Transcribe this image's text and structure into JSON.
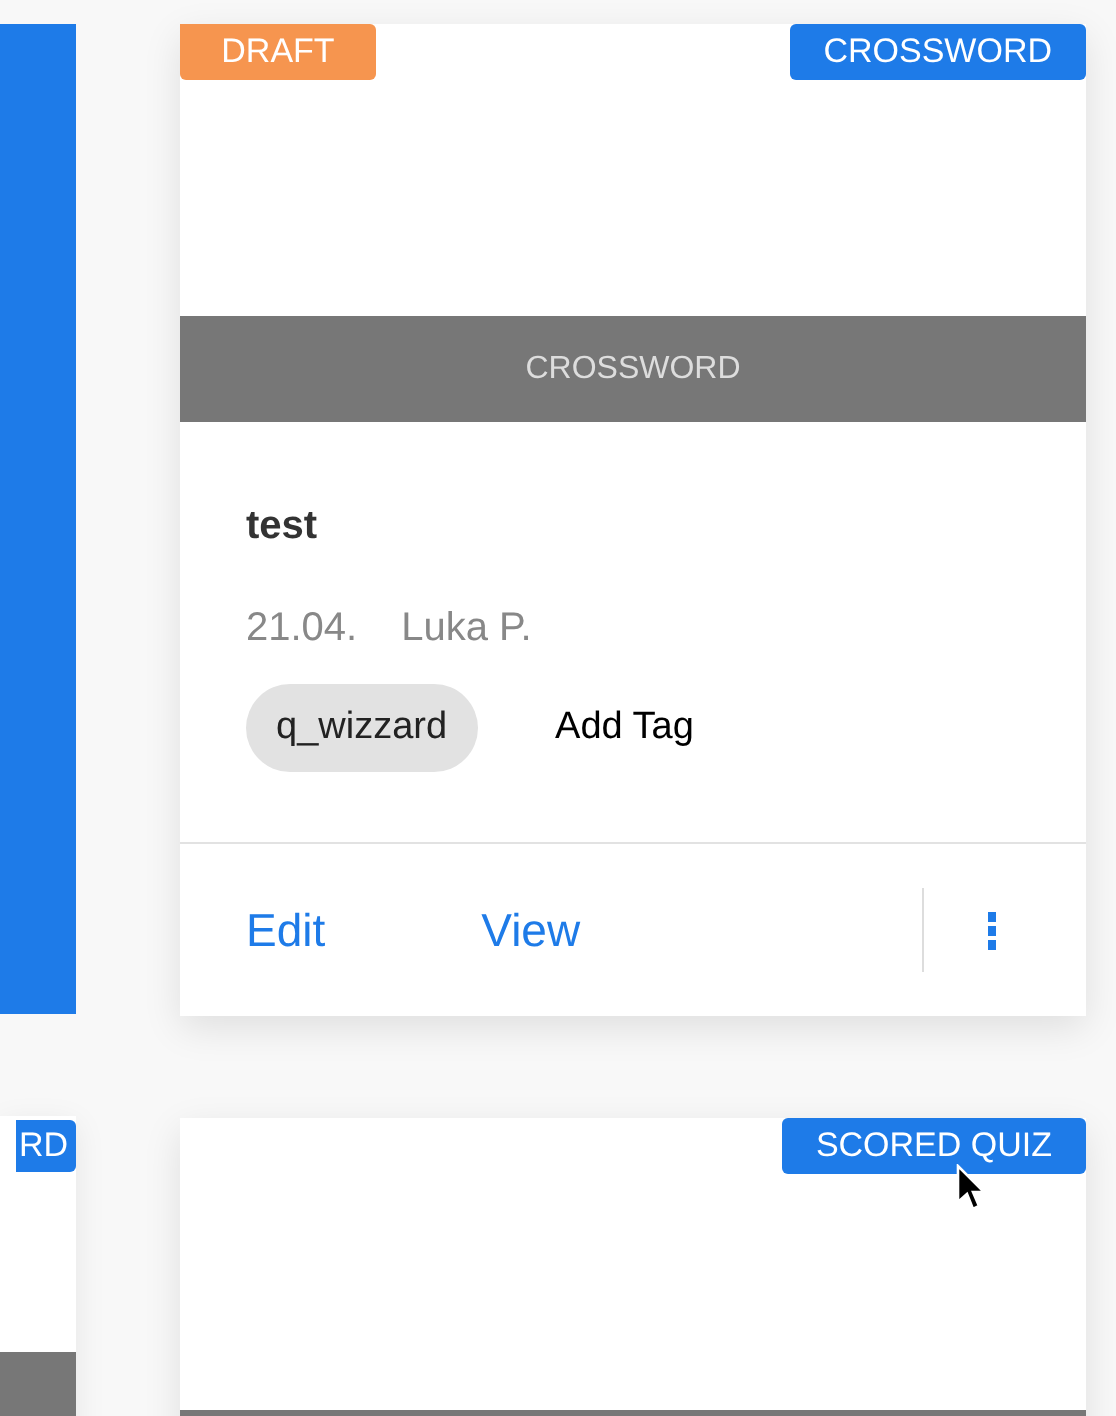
{
  "left_column": [
    {
      "kind": "solid"
    },
    {
      "kind": "cover",
      "type_badge": "RD"
    }
  ],
  "cards": [
    {
      "kind": "full",
      "status_badge": "DRAFT",
      "type_badge": "CROSSWORD",
      "band_label": "CROSSWORD",
      "title": "test",
      "date": "21.04.",
      "author": "Luka P.",
      "tags": [
        "q_wizzard"
      ],
      "add_tag": "Add Tag",
      "actions": [
        "Edit",
        "View"
      ]
    },
    {
      "kind": "cover",
      "type_badge": "SCORED QUIZ"
    }
  ]
}
